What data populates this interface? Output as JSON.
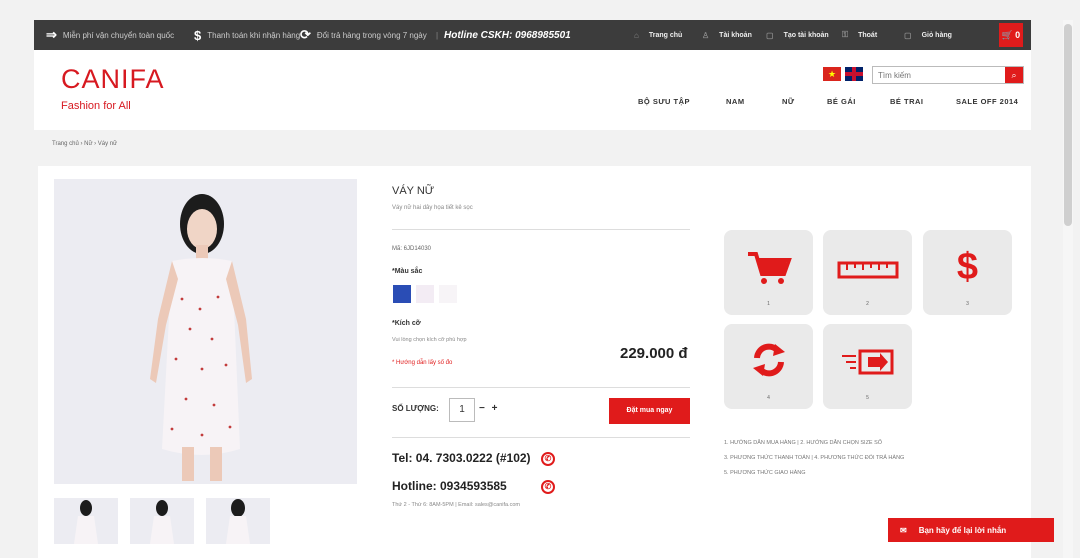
{
  "topbar": {
    "promo1": "Miễn phí vận chuyển toàn quốc",
    "promo2": "Thanh toán khi nhận hàng",
    "promo3": "Đổi trả hàng trong vòng 7 ngày",
    "hotline": "Hotline CSKH: 0968985501",
    "links": [
      "Trang chủ",
      "Tài khoản",
      "Tạo tài khoản",
      "Thoát",
      "Giỏ hàng"
    ],
    "cart_count": "0"
  },
  "header": {
    "logo": "CANIFA",
    "tagline": "Fashion for All",
    "search_placeholder": "Tìm kiếm",
    "nav": [
      "BỘ SƯU TẬP",
      "NAM",
      "NỮ",
      "BÉ GÁI",
      "BÉ TRAI",
      "SALE OFF 2014"
    ]
  },
  "breadcrumb": "Trang chủ › Nữ › Váy nữ",
  "product": {
    "title": "VÁY NỮ",
    "subtitle": "Váy nữ hai dây họa tiết kẻ sọc",
    "sku": "Mã: 6JD14030",
    "color_label": "*Màu sắc",
    "colors": [
      "#2a4db5",
      "#f3ecf4",
      "#f7f4f7"
    ],
    "size_label": "*Kích cỡ",
    "size_note": "Vui lòng chọn kích cỡ phù hợp",
    "size_guide": "* Hướng dẫn lấy số đo",
    "price": "229.000 đ",
    "qty_label": "SỐ LƯỢNG:",
    "qty_value": "1",
    "qty_minus": "−",
    "qty_plus": "+",
    "buy_label": "Đặt mua ngay",
    "tel": "Tel: 04. 7303.0222 (#102)",
    "hotline": "Hotline: 0934593585",
    "hours": "Thứ 2 - Thứ 6: 8AM-5PM | Email: sales@canifa.com"
  },
  "tiles": [
    {
      "icon": "cart-icon",
      "glyph": "🛒",
      "caption": "1"
    },
    {
      "icon": "ruler-icon",
      "glyph": "▭",
      "caption": "2"
    },
    {
      "icon": "dollar-icon",
      "glyph": "$",
      "caption": "3"
    },
    {
      "icon": "refresh-icon",
      "glyph": "⟳",
      "caption": "4"
    },
    {
      "icon": "delivery-icon",
      "glyph": "⇒",
      "caption": "5"
    }
  ],
  "guides": [
    "1. HƯỚNG DẪN MUA HÀNG | 2. HƯỚNG DẪN CHỌN SIZE SỐ",
    "3. PHƯƠNG THỨC THANH TOÁN | 4. PHƯƠNG THỨC ĐỔI TRẢ HÀNG",
    "5. PHƯƠNG THỨC GIAO HÀNG"
  ],
  "chat": "Bạn hãy để lại lời nhắn"
}
